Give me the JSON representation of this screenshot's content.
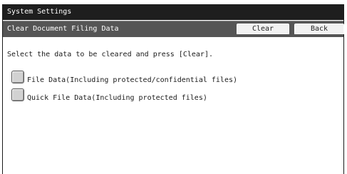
{
  "window": {
    "title": "System Settings"
  },
  "header": {
    "section_title": "Clear Document Filing Data",
    "clear_label": "Clear",
    "back_label": "Back"
  },
  "main": {
    "instruction": "Select the data to be cleared and press [Clear].",
    "options": [
      {
        "label": "File Data(Including protected/confidential files)",
        "checked": false
      },
      {
        "label": "Quick File Data(Including protected files)",
        "checked": false
      }
    ]
  }
}
